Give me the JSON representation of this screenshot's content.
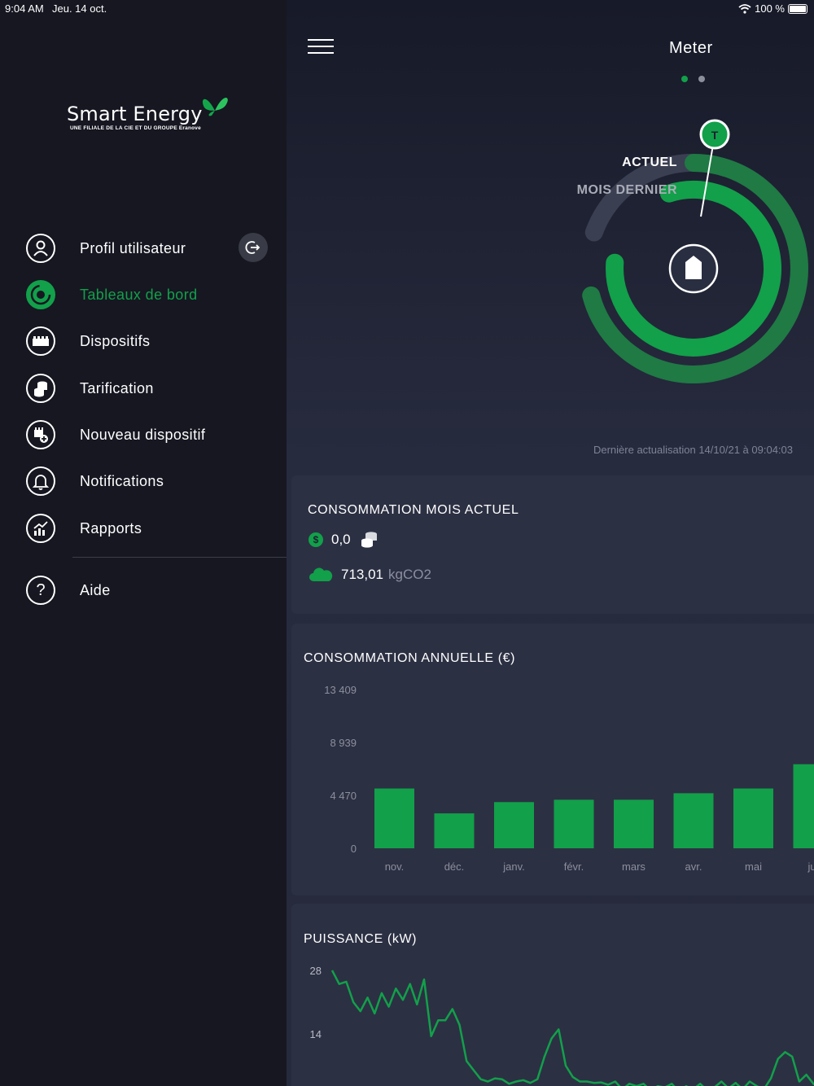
{
  "status_bar": {
    "time": "9:04 AM",
    "date": "Jeu. 14 oct.",
    "battery": "100 %"
  },
  "logo": {
    "brand": "Smart Energy",
    "tagline": "UNE FILIALE DE LA CIE ET DU GROUPE Eranove"
  },
  "sidebar": {
    "items": [
      {
        "label": "Profil utilisateur",
        "icon": "user-icon",
        "active": false
      },
      {
        "label": "Tableaux de bord",
        "icon": "dashboard-icon",
        "active": true
      },
      {
        "label": "Dispositifs",
        "icon": "meter-device-icon",
        "active": false
      },
      {
        "label": "Tarification",
        "icon": "coins-icon",
        "active": false
      },
      {
        "label": "Nouveau dispositif",
        "icon": "add-device-icon",
        "active": false
      },
      {
        "label": "Notifications",
        "icon": "bell-icon",
        "active": false
      },
      {
        "label": "Rapports",
        "icon": "report-chart-icon",
        "active": false
      },
      {
        "label": "Aide",
        "icon": "help-icon",
        "active": false
      }
    ]
  },
  "header": {
    "title": "Meter",
    "pages": 2,
    "current_page": 1
  },
  "gauge": {
    "label_current": "ACTUEL",
    "label_last": "MOIS DERNIER",
    "marker": "T",
    "current_fraction": 0.88,
    "last_fraction": 0.74
  },
  "last_update": "Dernière actualisation 14/10/21 à 09:04:03",
  "current_month": {
    "title": "CONSOMMATION MOIS ACTUEL",
    "cost": "0,0",
    "co2_value": "713,01",
    "co2_unit": "kgCO2"
  },
  "colors": {
    "accent": "#12a04a",
    "panel": "#2c3043",
    "sidebar": "#161721"
  },
  "chart_data": [
    {
      "type": "bar",
      "title": "CONSOMMATION ANNUELLE (€)",
      "categories": [
        "nov.",
        "déc.",
        "janv.",
        "févr.",
        "mars",
        "avr.",
        "mai",
        "jui"
      ],
      "values": [
        5050,
        2950,
        3900,
        4100,
        4100,
        4650,
        5050,
        7100
      ],
      "yticks": [
        "0",
        "4 470",
        "8 939",
        "13 409"
      ],
      "ylim": [
        0,
        13409
      ]
    },
    {
      "type": "line",
      "title": "PUISSANCE (kW)",
      "yticks": [
        "14",
        "28"
      ],
      "ylim": [
        0,
        28
      ],
      "values": [
        28,
        25,
        25.5,
        21,
        19,
        22,
        18.5,
        23,
        20,
        24,
        21.5,
        25,
        20.5,
        26,
        13.5,
        17,
        17,
        19.5,
        16,
        8,
        6,
        4,
        3.5,
        4.2,
        4,
        3,
        3.5,
        3.8,
        3.2,
        4,
        9,
        13,
        15,
        7,
        4.5,
        3.5,
        3.5,
        3.2,
        3.3,
        2.8,
        3.5,
        1.8,
        3,
        2.5,
        3,
        1.5,
        2.5,
        2.2,
        3,
        1.2,
        2.5,
        1.8,
        3,
        1.5,
        2.2,
        3.5,
        2,
        3.2,
        1.8,
        3.5,
        2.5,
        1.8,
        4.2,
        8.5,
        10,
        9,
        3.5,
        5,
        3,
        2
      ]
    }
  ]
}
